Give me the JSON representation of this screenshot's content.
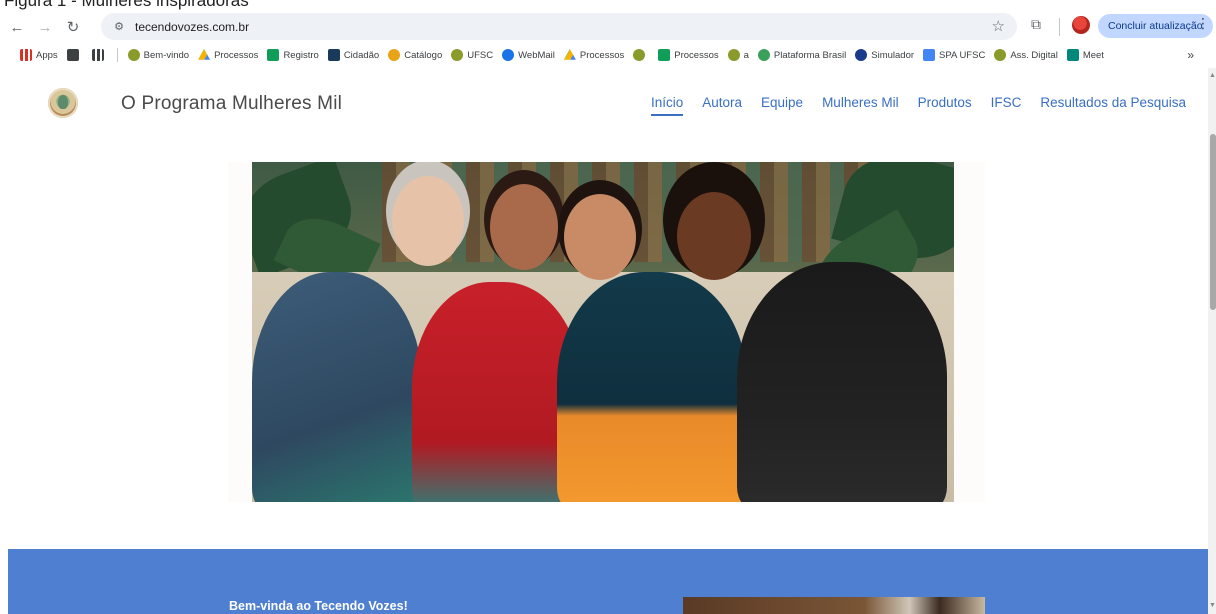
{
  "caption": "Figura 1 - Mulheres inspiradoras",
  "browser": {
    "url": "tecendovozes.com.br",
    "update_button": "Concluir atualização",
    "bookmarks": [
      {
        "label": "Apps",
        "icon": "apps-grid-icon",
        "color": "#d93025"
      },
      {
        "label": "",
        "icon": "square-icon",
        "color": "#3c4043"
      },
      {
        "label": "",
        "icon": "grid-icon",
        "color": "#3c4043"
      },
      {
        "label": "Bem-vindo",
        "icon": "university-icon",
        "color": "#8a9a2b"
      },
      {
        "label": "Processos",
        "icon": "drive-icon",
        "color": "#f4b400"
      },
      {
        "label": "Registro",
        "icon": "plus-doc-icon",
        "color": "#0f9d58"
      },
      {
        "label": "Cidadão",
        "icon": "gov-icon",
        "color": "#1a3a5c"
      },
      {
        "label": "Catálogo",
        "icon": "leaf-icon",
        "color": "#e8a317"
      },
      {
        "label": "UFSC",
        "icon": "university-icon",
        "color": "#8a9a2b"
      },
      {
        "label": "WebMail",
        "icon": "mail-icon",
        "color": "#1a73e8"
      },
      {
        "label": "Processos",
        "icon": "drive-icon",
        "color": "#f4b400"
      },
      {
        "label": "",
        "icon": "university-icon",
        "color": "#8a9a2b"
      },
      {
        "label": "Processos",
        "icon": "plus-doc-icon",
        "color": "#0f9d58"
      },
      {
        "label": "a",
        "icon": "university-icon",
        "color": "#8a9a2b"
      },
      {
        "label": "Plataforma Brasil",
        "icon": "leaf-icon",
        "color": "#3aa05a"
      },
      {
        "label": "Simulador",
        "icon": "shield-icon",
        "color": "#1a3a8c"
      },
      {
        "label": "SPA UFSC",
        "icon": "google-icon",
        "color": "#4285f4"
      },
      {
        "label": "Ass. Digital",
        "icon": "university-icon",
        "color": "#8a9a2b"
      },
      {
        "label": "Meet",
        "icon": "meet-icon",
        "color": "#00897b"
      }
    ],
    "bookmarks_more": "»"
  },
  "site": {
    "title": "O Programa Mulheres Mil",
    "nav": [
      {
        "label": "Início",
        "active": true
      },
      {
        "label": "Autora",
        "active": false
      },
      {
        "label": "Equipe",
        "active": false
      },
      {
        "label": "Mulheres Mil",
        "active": false
      },
      {
        "label": "Produtos",
        "active": false
      },
      {
        "label": "IFSC",
        "active": false
      },
      {
        "label": "Resultados da Pesquisa",
        "active": false
      }
    ],
    "welcome_heading": "Bem-vinda ao Tecendo Vozes!",
    "accent_color": "#3a6fc4",
    "section_color": "#4f7fd1"
  }
}
